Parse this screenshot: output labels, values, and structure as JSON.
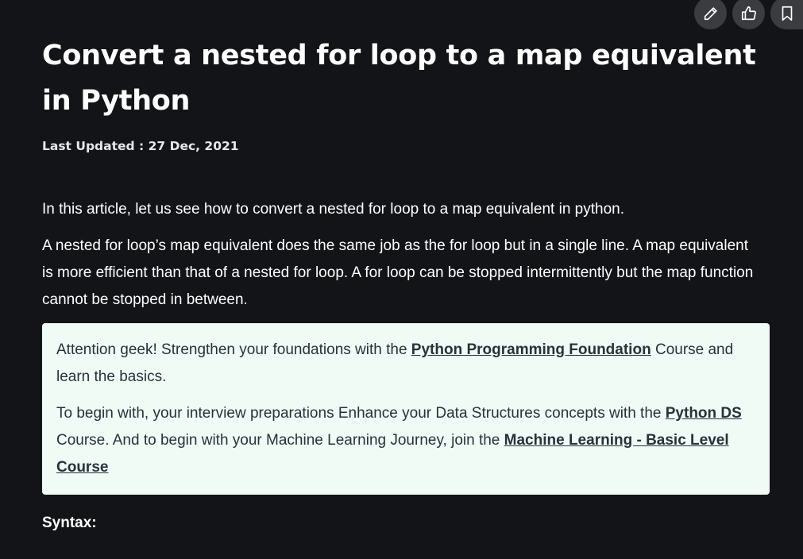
{
  "article": {
    "title": "Convert a nested for loop to a map equivalent in Python",
    "last_updated": "Last Updated : 27 Dec, 2021",
    "paragraph1": "In this article, let us see how to convert a nested for loop to a map equivalent in python.",
    "paragraph2": "A nested for loop’s map equivalent does the same job as the for loop but in a single line. A map equivalent is more efficient than that of a nested for loop. A for loop can be stopped intermittently but the map function cannot be stopped in between.",
    "syntax_heading": "Syntax:"
  },
  "callout": {
    "line1_prefix": " Attention geek! Strengthen your foundations with the ",
    "line1_link": "Python Programming Foundation",
    "line1_suffix": " Course and learn the basics.",
    "line2_prefix": "To begin with, your interview preparations Enhance your Data Structures concepts with the ",
    "line2_link1": "Python DS",
    "line2_middle": " Course. And to begin with your Machine Learning Journey, join the ",
    "line2_link2": "Machine Learning - Basic Level Course"
  },
  "toolbar": {
    "icons": [
      "pencil-icon",
      "thumbs-up-icon",
      "bookmark-icon"
    ]
  }
}
